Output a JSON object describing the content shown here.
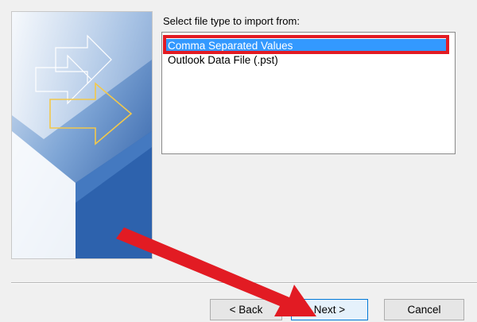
{
  "dialog": {
    "prompt": "Select file type to import from:"
  },
  "file_types": {
    "items": [
      {
        "label": "Comma Separated Values",
        "selected": true
      },
      {
        "label": "Outlook Data File (.pst)",
        "selected": false
      }
    ]
  },
  "buttons": {
    "back": "< Back",
    "next": "Next >",
    "cancel": "Cancel"
  },
  "colors": {
    "selection": "#3399ff",
    "highlight": "#e21b23",
    "arrow": "#e21b23",
    "art_blue": "#1a4f9c"
  }
}
